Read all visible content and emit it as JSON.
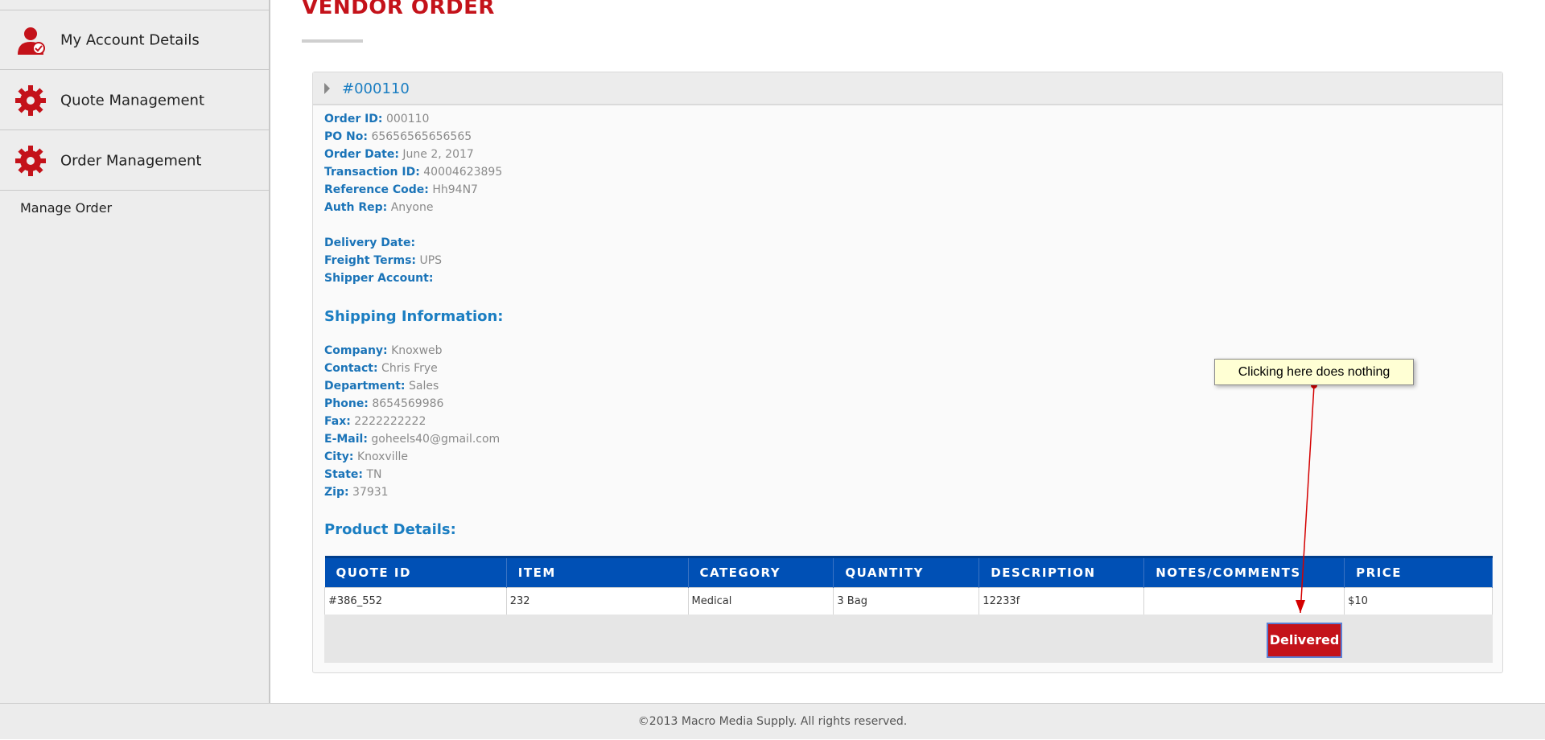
{
  "sidebar": {
    "items": [
      {
        "label": "My Account Details",
        "icon": "user-account-icon"
      },
      {
        "label": "Quote Management",
        "icon": "gear-icon"
      },
      {
        "label": "Order Management",
        "icon": "gear-icon"
      }
    ],
    "subitems": [
      {
        "label": "Manage Order"
      }
    ]
  },
  "page": {
    "title": "VENDOR ORDER"
  },
  "order": {
    "header_number": "#000110",
    "fields": [
      {
        "key": "Order ID:",
        "value": "000110"
      },
      {
        "key": "PO No:",
        "value": "65656565656565"
      },
      {
        "key": "Order Date:",
        "value": "June 2, 2017"
      },
      {
        "key": "Transaction ID:",
        "value": "40004623895"
      },
      {
        "key": "Reference Code:",
        "value": "Hh94N7"
      },
      {
        "key": "Auth Rep:",
        "value": "Anyone"
      },
      {
        "key": "Delivery Date:",
        "value": ""
      },
      {
        "key": "Freight Terms:",
        "value": "UPS"
      },
      {
        "key": "Shipper Account:",
        "value": ""
      }
    ],
    "shipping_heading": "Shipping Information:",
    "shipping": [
      {
        "key": "Company:",
        "value": "Knoxweb"
      },
      {
        "key": "Contact:",
        "value": "Chris Frye"
      },
      {
        "key": "Department:",
        "value": "Sales"
      },
      {
        "key": "Phone:",
        "value": "8654569986"
      },
      {
        "key": "Fax:",
        "value": "2222222222"
      },
      {
        "key": "E-Mail:",
        "value": "goheels40@gmail.com"
      },
      {
        "key": "City:",
        "value": "Knoxville"
      },
      {
        "key": "State:",
        "value": "TN"
      },
      {
        "key": "Zip:",
        "value": "37931"
      }
    ],
    "product_heading": "Product Details:",
    "table": {
      "headers": [
        "QUOTE ID",
        "ITEM",
        "CATEGORY",
        "QUANTITY",
        "DESCRIPTION",
        "NOTES/COMMENTS",
        "PRICE"
      ],
      "rows": [
        [
          "#386_552",
          "232",
          "Medical",
          "3 Bag",
          "12233f",
          "",
          "$10"
        ]
      ]
    },
    "status_button": "Delivered"
  },
  "annotation": {
    "text": "Clicking here does nothing",
    "color": "#d40000"
  },
  "footer": {
    "text": "©2013 Macro Media Supply. All rights reserved."
  },
  "colors": {
    "accent_red": "#c4121a",
    "link_blue": "#1b7ec2",
    "table_header_blue": "#0050b5"
  }
}
